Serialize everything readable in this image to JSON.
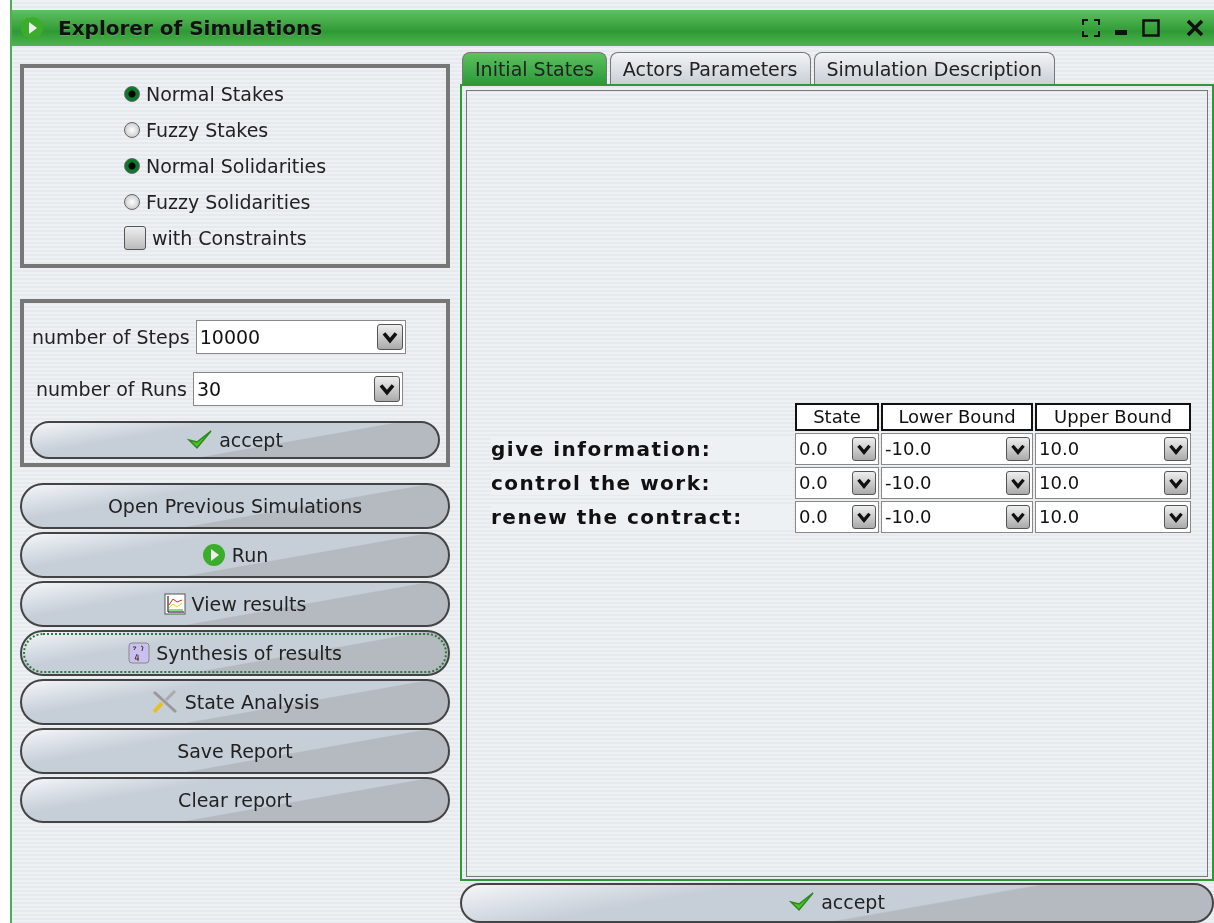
{
  "window": {
    "title": "Explorer of Simulations"
  },
  "options": [
    {
      "kind": "radio",
      "label": "Normal Stakes",
      "checked": true
    },
    {
      "kind": "radio",
      "label": "Fuzzy Stakes",
      "checked": false
    },
    {
      "kind": "radio",
      "label": "Normal Solidarities",
      "checked": true
    },
    {
      "kind": "radio",
      "label": "Fuzzy Solidarities",
      "checked": false
    },
    {
      "kind": "checkbox",
      "label": "with Constraints",
      "checked": false
    }
  ],
  "settings": [
    {
      "label": "number of Steps",
      "value": "10000"
    },
    {
      "label": "number of Runs",
      "value": "30"
    }
  ],
  "settings_accept": "accept",
  "actions": [
    {
      "label": "Open Previous Simulations",
      "focused": false
    },
    {
      "label": "Run",
      "focused": false
    },
    {
      "label": "View results",
      "focused": false
    },
    {
      "label": "Synthesis of results",
      "focused": true
    },
    {
      "label": "State Analysis",
      "focused": false
    },
    {
      "label": "Save Report",
      "focused": false
    },
    {
      "label": "Clear report",
      "focused": false
    }
  ],
  "tabs": [
    {
      "label": "Initial States",
      "selected": true
    },
    {
      "label": "Actors Parameters",
      "selected": false
    },
    {
      "label": "Simulation Description",
      "selected": false
    }
  ],
  "table": {
    "columns": [
      "State",
      "Lower Bound",
      "Upper Bound"
    ],
    "rows": [
      {
        "label": "give information:",
        "values": [
          "0.0",
          "-10.0",
          "10.0"
        ]
      },
      {
        "label": "control the work:",
        "values": [
          "0.0",
          "-10.0",
          "10.0"
        ]
      },
      {
        "label": "renew the contract:",
        "values": [
          "0.0",
          "-10.0",
          "10.0"
        ]
      }
    ]
  },
  "accept": "accept"
}
